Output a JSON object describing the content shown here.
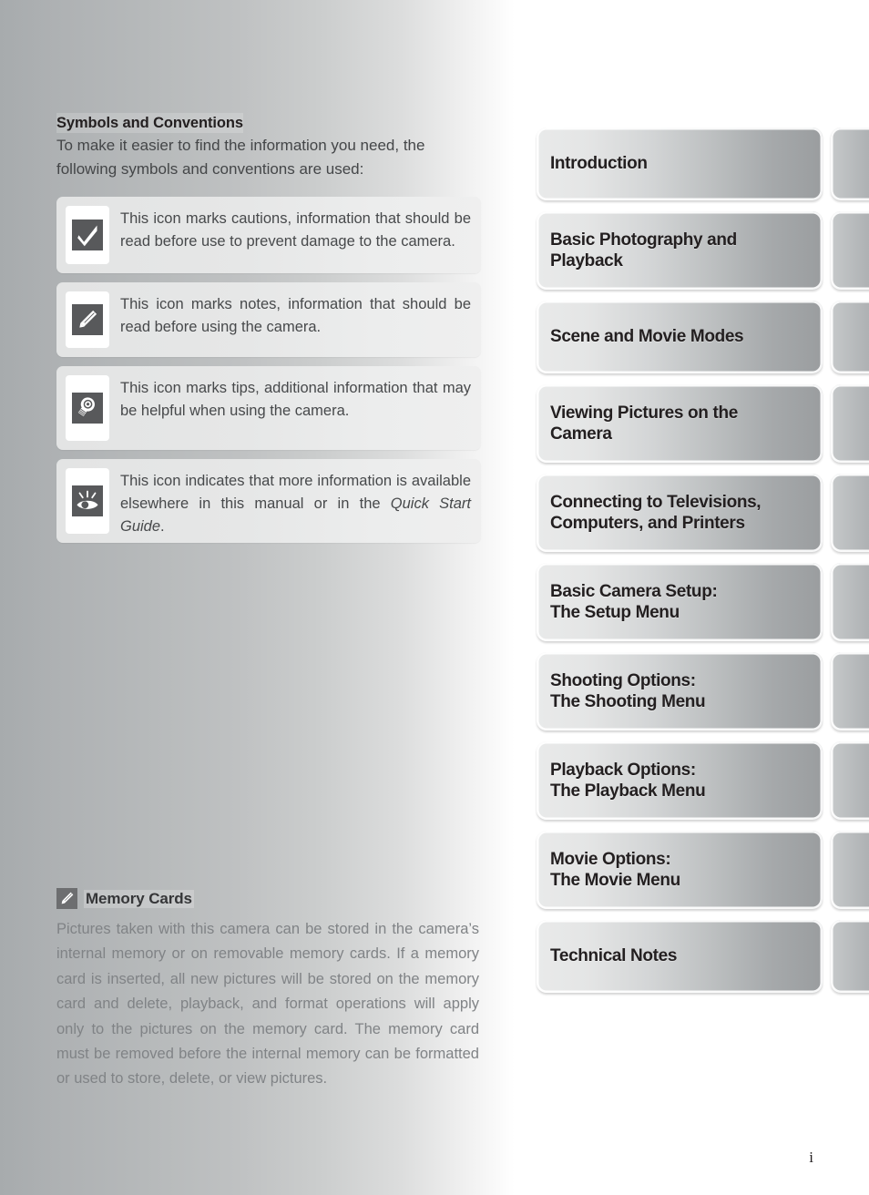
{
  "page": {
    "number": "i"
  },
  "left": {
    "section_title": "Symbols and Conventions",
    "intro": "To make it easier to find the information you need, the following symbols and conventions are used:",
    "legend": [
      {
        "icon": "checkmark-icon",
        "text": "This icon marks cautions, information that should be read before use to prevent damage to the camera."
      },
      {
        "icon": "pencil-icon",
        "text": "This icon marks notes, information that should be read before using the camera."
      },
      {
        "icon": "lightbulb-icon",
        "text": "This icon marks tips, additional information that may be helpful when using the camera."
      },
      {
        "icon": "eye-icon",
        "text_before_italic": "This icon indicates that more information is available elsewhere in this manual or in the ",
        "text_italic": "Quick Start Guide",
        "text_after_italic": "."
      }
    ]
  },
  "note": {
    "icon": "pencil-icon",
    "title": "Memory Cards",
    "body": "Pictures taken with this camera can be stored in the camera’s internal memory or on removable memory cards.  If a memory card is inserted, all new pictures will be stored on the memory card and delete, playback, and format operations will apply only to the pictures on the memory card.  The memory card must be removed before the internal memory can be formatted or used to store, delete, or view pictures."
  },
  "tabs": {
    "items": [
      {
        "label": "Introduction",
        "lines": 1
      },
      {
        "label": "Basic Photography and\nPlayback",
        "lines": 2
      },
      {
        "label": "Scene and Movie Modes",
        "lines": 1
      },
      {
        "label": "Viewing Pictures on the\nCamera",
        "lines": 2
      },
      {
        "label": "Connecting to Televisions,\nComputers, and Printers",
        "lines": 2
      },
      {
        "label": "Basic Camera Setup:\nThe Setup Menu",
        "lines": 2
      },
      {
        "label": "Shooting Options:\nThe Shooting Menu",
        "lines": 2
      },
      {
        "label": "Playback Options:\nThe Playback Menu",
        "lines": 2
      },
      {
        "label": "Movie Options:\nThe Movie Menu",
        "lines": 2
      },
      {
        "label": "Technical Notes",
        "lines": 1
      }
    ]
  },
  "colors": {
    "background_left": "#a7abad",
    "background_right": "#ffffff",
    "icon_square": "#58595b",
    "text_body": "#47494b",
    "text_note": "#808386",
    "tab_gradient_start": "#e9eaea",
    "tab_gradient_end": "#9a9d9f"
  }
}
